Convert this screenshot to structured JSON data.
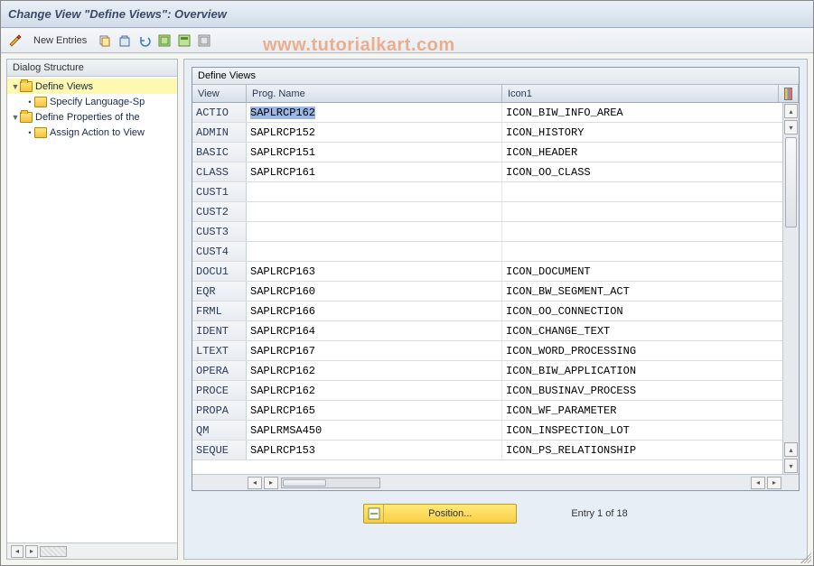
{
  "title": "Change View \"Define Views\": Overview",
  "watermark": "www.tutorialkart.com",
  "toolbar": {
    "new_entries": "New Entries"
  },
  "sidebar": {
    "title": "Dialog Structure",
    "nodes": [
      {
        "label": "Define Views",
        "level": 0,
        "expanded": true,
        "selected": true
      },
      {
        "label": "Specify Language-Sp",
        "level": 1,
        "expanded": false,
        "selected": false
      },
      {
        "label": "Define Properties of the",
        "level": 0,
        "expanded": true,
        "selected": false
      },
      {
        "label": "Assign Action to View",
        "level": 1,
        "expanded": false,
        "selected": false
      }
    ]
  },
  "grid": {
    "title": "Define Views",
    "columns": {
      "view": "View",
      "prog": "Prog. Name",
      "icon": "Icon1"
    },
    "rows": [
      {
        "view": "ACTIO",
        "prog": "SAPLRCP162",
        "icon": "ICON_BIW_INFO_AREA",
        "selected": true
      },
      {
        "view": "ADMIN",
        "prog": "SAPLRCP152",
        "icon": "ICON_HISTORY"
      },
      {
        "view": "BASIC",
        "prog": "SAPLRCP151",
        "icon": "ICON_HEADER"
      },
      {
        "view": "CLASS",
        "prog": "SAPLRCP161",
        "icon": "ICON_OO_CLASS"
      },
      {
        "view": "CUST1",
        "prog": "",
        "icon": ""
      },
      {
        "view": "CUST2",
        "prog": "",
        "icon": ""
      },
      {
        "view": "CUST3",
        "prog": "",
        "icon": ""
      },
      {
        "view": "CUST4",
        "prog": "",
        "icon": ""
      },
      {
        "view": "DOCU1",
        "prog": "SAPLRCP163",
        "icon": "ICON_DOCUMENT"
      },
      {
        "view": "EQR",
        "prog": "SAPLRCP160",
        "icon": "ICON_BW_SEGMENT_ACT"
      },
      {
        "view": "FRML",
        "prog": "SAPLRCP166",
        "icon": "ICON_OO_CONNECTION"
      },
      {
        "view": "IDENT",
        "prog": "SAPLRCP164",
        "icon": "ICON_CHANGE_TEXT"
      },
      {
        "view": "LTEXT",
        "prog": "SAPLRCP167",
        "icon": "ICON_WORD_PROCESSING"
      },
      {
        "view": "OPERA",
        "prog": "SAPLRCP162",
        "icon": "ICON_BIW_APPLICATION"
      },
      {
        "view": "PROCE",
        "prog": "SAPLRCP162",
        "icon": "ICON_BUSINAV_PROCESS"
      },
      {
        "view": "PROPA",
        "prog": "SAPLRCP165",
        "icon": "ICON_WF_PARAMETER"
      },
      {
        "view": "QM",
        "prog": "SAPLRMSA450",
        "icon": "ICON_INSPECTION_LOT"
      },
      {
        "view": "SEQUE",
        "prog": "SAPLRCP153",
        "icon": "ICON_PS_RELATIONSHIP"
      }
    ]
  },
  "footer": {
    "position_label": "Position...",
    "entry_text": "Entry 1 of 18"
  }
}
